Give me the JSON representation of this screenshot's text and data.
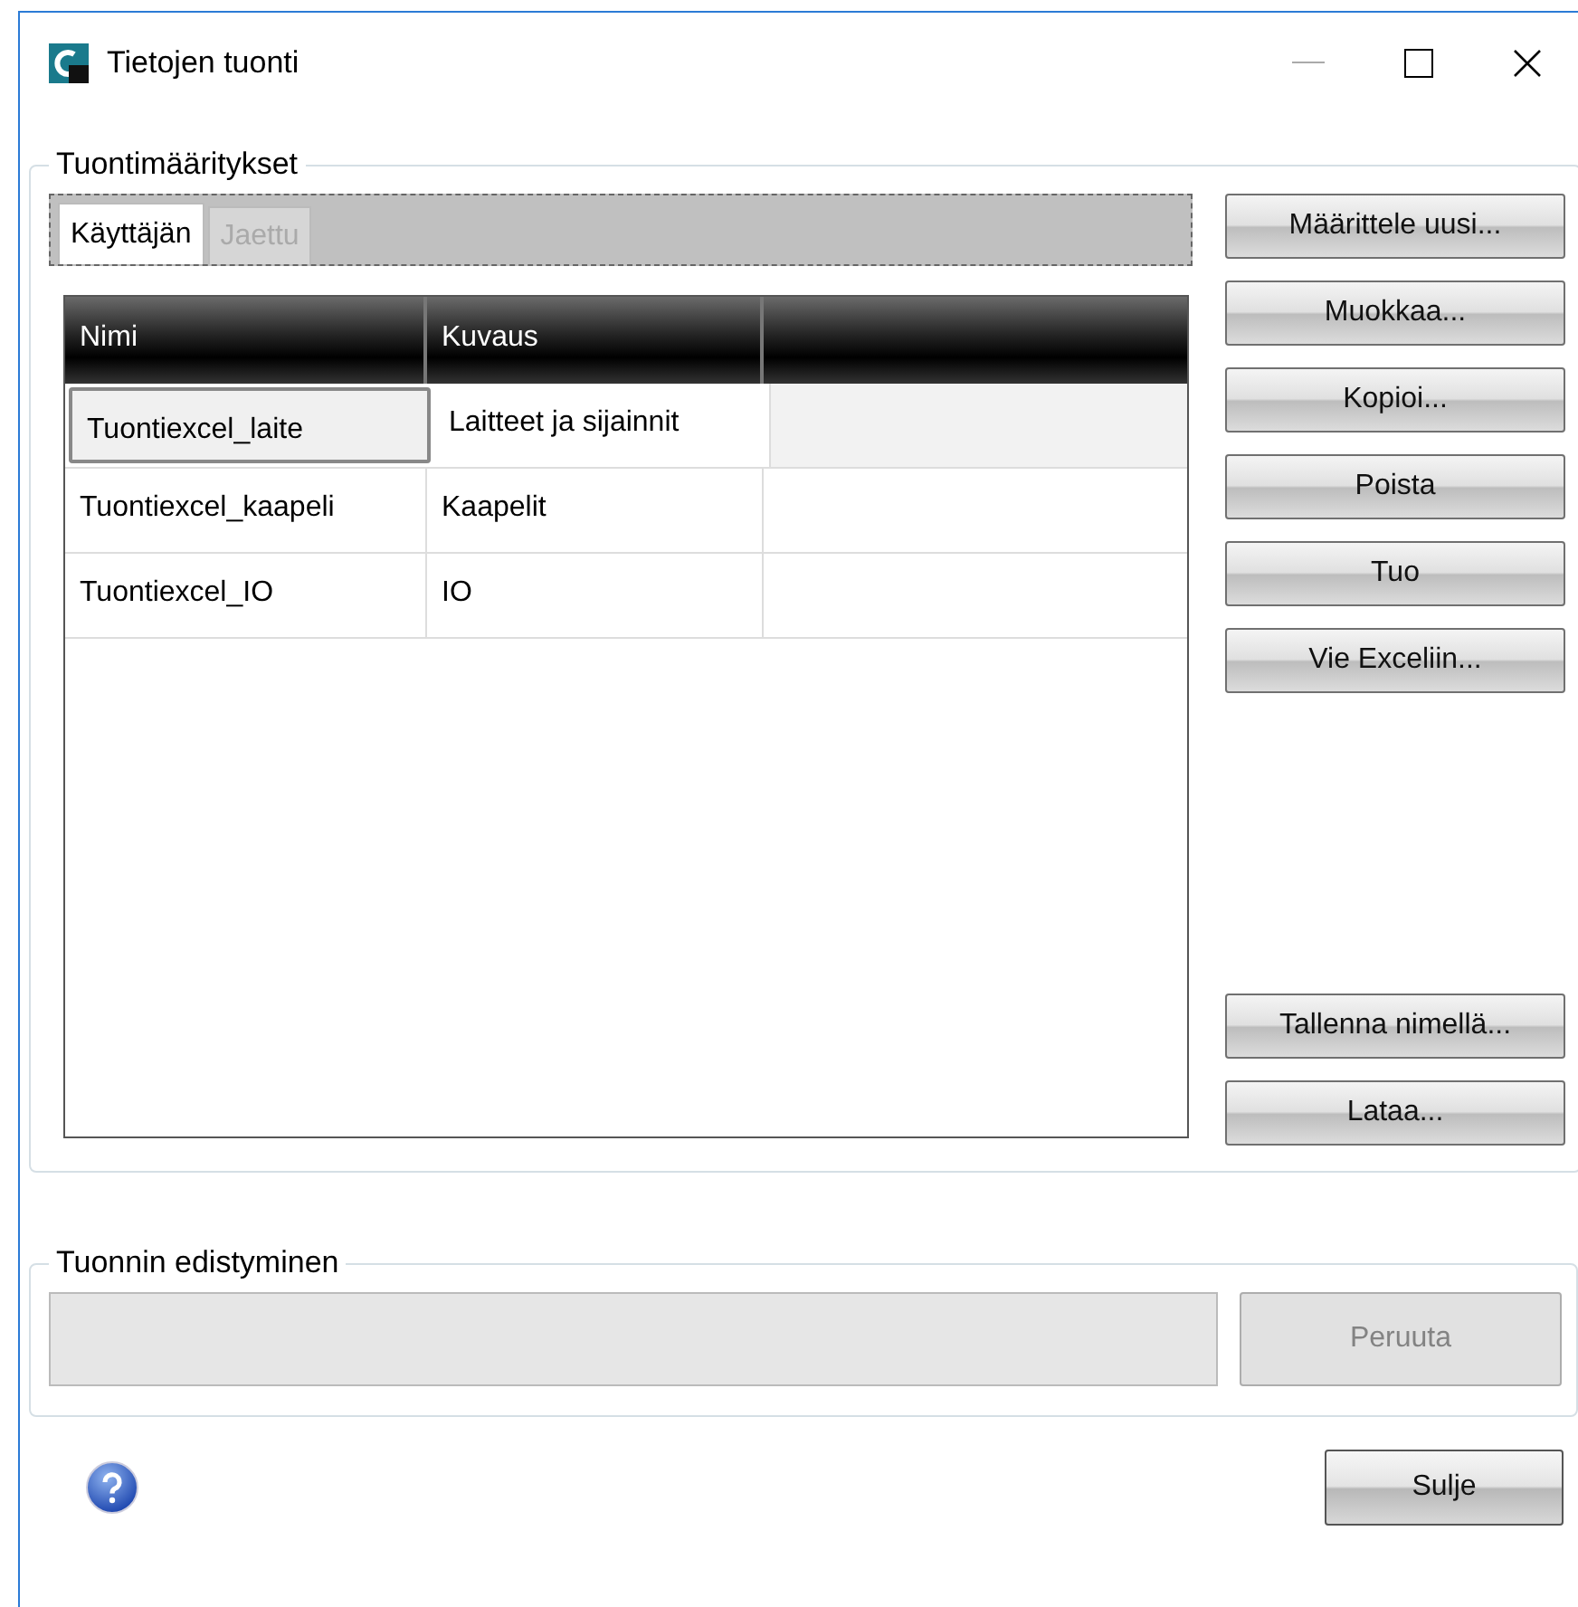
{
  "window": {
    "title": "Tietojen tuonti"
  },
  "definitions": {
    "title": "Tuontimääritykset",
    "tabs": [
      {
        "label": "Käyttäjän",
        "selected": true,
        "disabled": false
      },
      {
        "label": "Jaettu",
        "selected": false,
        "disabled": true
      }
    ],
    "table": {
      "columns": [
        "Nimi",
        "Kuvaus"
      ],
      "rows": [
        {
          "cells": [
            "Tuontiexcel_laite",
            "Laitteet ja sijainnit"
          ],
          "selected": true
        },
        {
          "cells": [
            "Tuontiexcel_kaapeli",
            "Kaapelit"
          ],
          "selected": false
        },
        {
          "cells": [
            "Tuontiexcel_IO",
            "IO"
          ],
          "selected": false
        }
      ]
    },
    "buttons": [
      "Määrittele uusi...",
      "Muokkaa...",
      "Kopioi...",
      "Poista",
      "Tuo",
      "Vie Exceliin..."
    ],
    "lower_buttons": [
      "Tallenna nimellä...",
      "Lataa..."
    ]
  },
  "progress": {
    "title": "Tuonnin edistyminen",
    "cancel": {
      "label": "Peruuta",
      "disabled": true
    }
  },
  "close_button": "Sulje"
}
